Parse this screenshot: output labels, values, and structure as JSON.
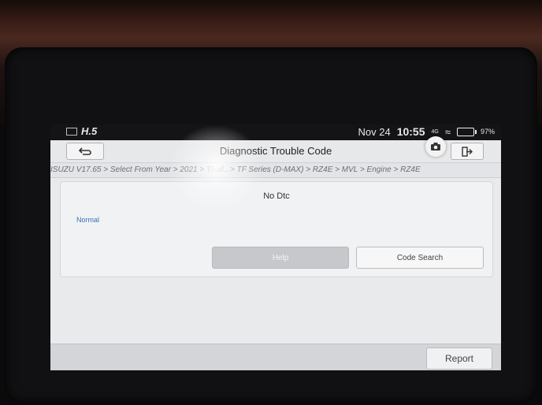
{
  "status_bar": {
    "app_indicator": "H.5",
    "date": "Nov 24",
    "time": "10:55",
    "signal_text": "4G",
    "battery": "97%"
  },
  "header": {
    "title": "Diagnostic Trouble Code",
    "back_icon": "back-arrow-icon",
    "camera_icon": "camera-icon",
    "exit_icon": "exit-icon"
  },
  "breadcrumb": "ISUZU V17.65 > Select From Year > 2021 > Thail...> TF Series (D-MAX) > RZ4E > MVL > Engine > RZ4E",
  "main": {
    "message": "No Dtc",
    "status": "Normal",
    "help_label": "Help",
    "code_search_label": "Code Search"
  },
  "footer": {
    "report_label": "Report"
  },
  "colors": {
    "status_text": "#3b6fb8",
    "screen_bg": "#e9eaec",
    "statusbar_bg": "#141416"
  }
}
